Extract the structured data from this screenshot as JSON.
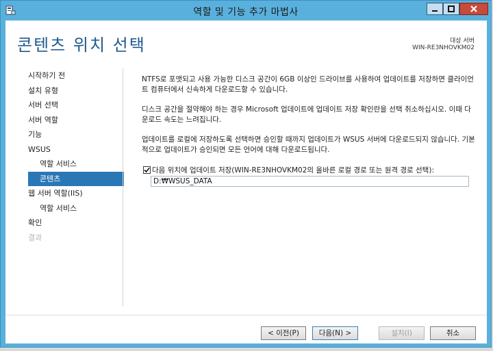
{
  "window": {
    "title": "역할 및 기능 추가 마법사"
  },
  "header": {
    "page_title": "콘텐츠 위치 선택",
    "target_label": "대상 서버",
    "target_server": "WIN-RE3NHOVKM02"
  },
  "nav": {
    "items": [
      {
        "label": "시작하기 전",
        "state": "normal"
      },
      {
        "label": "설치 유형",
        "state": "normal"
      },
      {
        "label": "서버 선택",
        "state": "normal"
      },
      {
        "label": "서버 역할",
        "state": "normal"
      },
      {
        "label": "기능",
        "state": "normal"
      },
      {
        "label": "WSUS",
        "state": "normal"
      },
      {
        "label": "역할 서비스",
        "state": "sub"
      },
      {
        "label": "콘텐츠",
        "state": "active"
      },
      {
        "label": "웹 서버 역할(IIS)",
        "state": "normal"
      },
      {
        "label": "역할 서비스",
        "state": "sub"
      },
      {
        "label": "확인",
        "state": "normal"
      },
      {
        "label": "결과",
        "state": "disabled"
      }
    ]
  },
  "content": {
    "para1": "NTFS로 포맷되고 사용 가능한 디스크 공간이 6GB 이상인 드라이브를 사용하여 업데이트를 저장하면 클라이언트 컴퓨터에서 신속하게 다운로드할 수 있습니다.",
    "para2": "디스크 공간을 절약해야 하는 경우 Microsoft 업데이트에 업데이트 저장 확인란을 선택 취소하십시오. 이때 다운로드 속도는 느려집니다.",
    "para3": "업데이트를 로컬에 저장하도록 선택하면 승인할 때까지 업데이트가 WSUS 서버에 다운로드되지 않습니다. 기본적으로 업데이트가 승인되면 모든 언어에 대해 다운로드됩니다.",
    "checkbox_label": "다음 위치에 업데이트 저장(WIN-RE3NHOVKM02의 올바른 로컬 경로 또는 원격 경로 선택):",
    "checkbox_checked": true,
    "path_value": "D:₩WSUS_DATA"
  },
  "buttons": {
    "prev": "< 이전(P)",
    "next": "다음(N) >",
    "install": "설치(I)",
    "cancel": "취소"
  },
  "colors": {
    "titlebar": "#5ab0dc",
    "title_text": "#1e5a8e",
    "nav_active": "#2a77b6"
  }
}
